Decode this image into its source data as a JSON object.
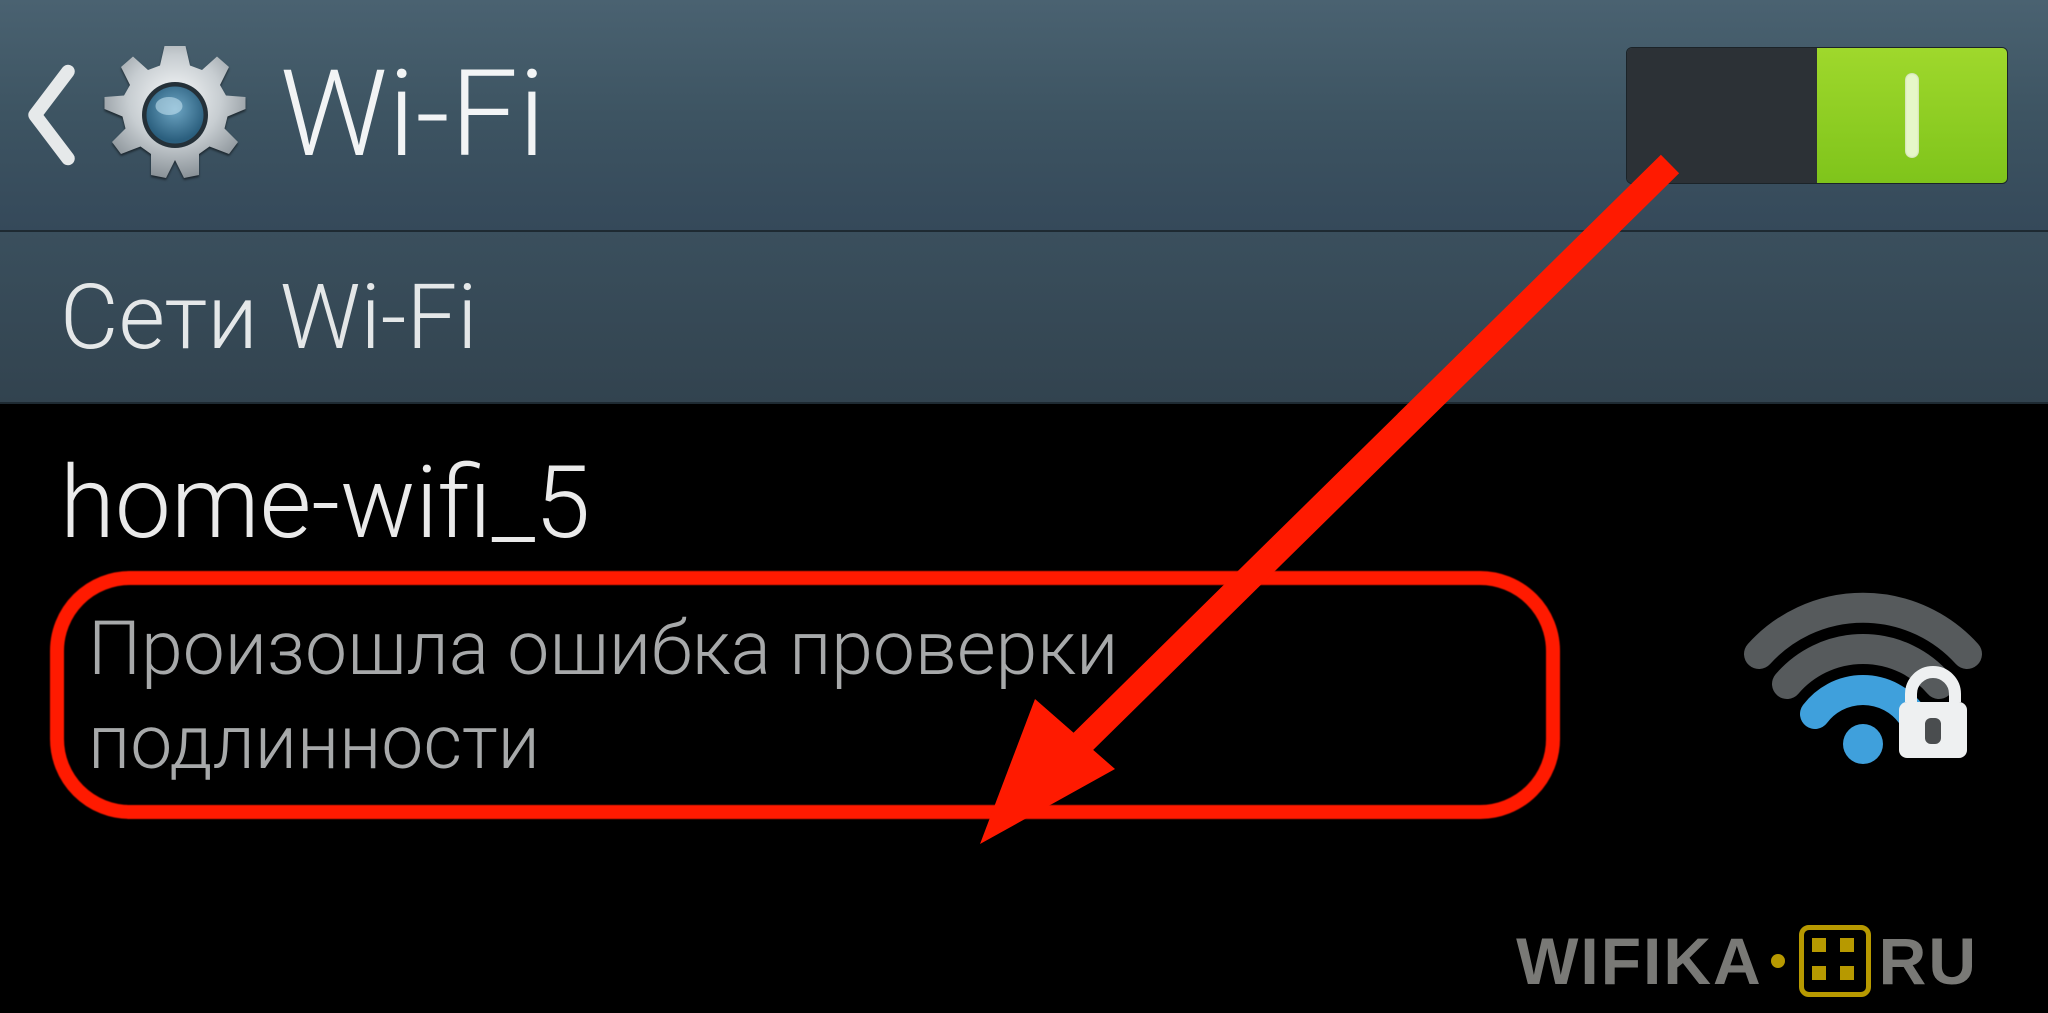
{
  "header": {
    "title": "Wi-Fi",
    "toggle_on": true
  },
  "section": {
    "label": "Сети Wi-Fi"
  },
  "network": {
    "name": "home-wifi_5",
    "status": "Произошла ошибка проверки подлинности"
  },
  "watermark": {
    "left": "WIFIKA",
    "right": "RU"
  },
  "annotation": {
    "highlight_color": "#ff1a00"
  }
}
